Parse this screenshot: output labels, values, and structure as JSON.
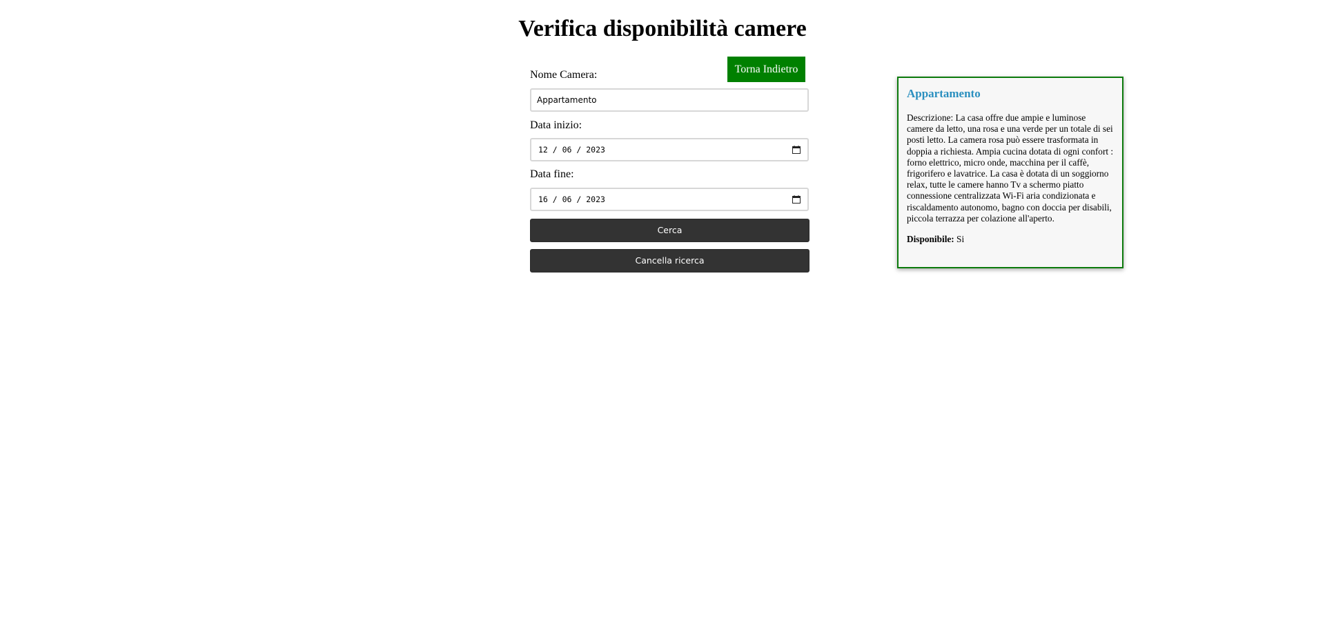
{
  "page": {
    "title": "Verifica disponibilità camere"
  },
  "header": {
    "back_label": "Torna Indietro"
  },
  "form": {
    "room_name_label": "Nome Camera:",
    "room_name_value": "Appartamento",
    "start_date_label": "Data inizio:",
    "start_date_value": "12 / 06 / 2023",
    "end_date_label": "Data fine:",
    "end_date_value": "16 / 06 / 2023",
    "search_label": "Cerca",
    "clear_label": "Cancella ricerca"
  },
  "result": {
    "title": "Appartamento",
    "description": "Descrizione: La casa offre due ampie e luminose camere da letto, una rosa e una verde per un totale di sei posti letto. La camera rosa può essere trasformata in doppia a richiesta. Ampia cucina dotata di ogni confort : forno elettrico, micro onde, macchina per il caffè, frigorifero e lavatrice. La casa è dotata di un soggiorno relax, tutte le camere hanno Tv a schermo piatto connessione centralizzata Wi-Fi aria condizionata e riscaldamento autonomo, bagno con doccia per disabili, piccola terrazza per colazione all'aperto.",
    "available_label": "Disponibile:",
    "available_value": "Si"
  },
  "colors": {
    "back_button": "#008000",
    "action_button": "#333333",
    "card_border": "#0b7a0b",
    "card_title": "#2a8fbf",
    "card_background": "#f7f7f7"
  },
  "icons": {
    "date_picker": "calendar-icon"
  }
}
